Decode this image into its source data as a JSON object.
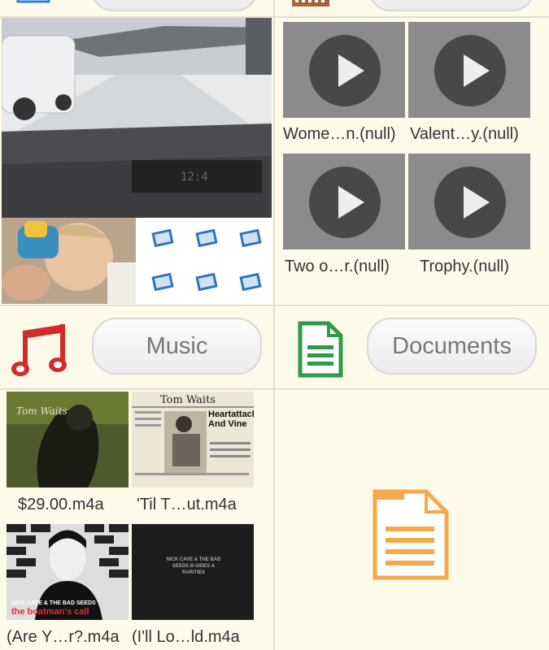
{
  "sections": {
    "music": {
      "button_label": "Music"
    },
    "documents": {
      "button_label": "Documents"
    }
  },
  "videos": [
    {
      "caption": "Wome…n.(null)"
    },
    {
      "caption": "Valent…y.(null)"
    },
    {
      "caption": "Two o…r.(null)"
    },
    {
      "caption": "Trophy.(null)"
    }
  ],
  "music_files": [
    {
      "caption": "$29.00.m4a",
      "art_text": "Tom Waits"
    },
    {
      "caption": "'Til T…ut.m4a",
      "art_title": "Tom Waits",
      "art_headline": "Heartattack And Vine"
    },
    {
      "caption": "(Are Y…r?.m4a",
      "art_artist": "NICK CAVE & THE BAD SEEDS",
      "art_album": "the boatman's call"
    },
    {
      "caption": "(I'll Lo…ld.m4a",
      "art_text": "NICK CAVE & THE BAD SEEDS B-SIDES & RARITIES"
    }
  ],
  "colors": {
    "background": "#fdfaea",
    "music_icon": "#d32b2b",
    "documents_icon": "#2e9b48",
    "document_large_icon": "#f7a94a"
  },
  "icons": {
    "photos": "photos-icon",
    "video": "film-strip-icon",
    "music": "music-note-icon",
    "documents": "document-icon",
    "document_large": "document-large-icon"
  }
}
